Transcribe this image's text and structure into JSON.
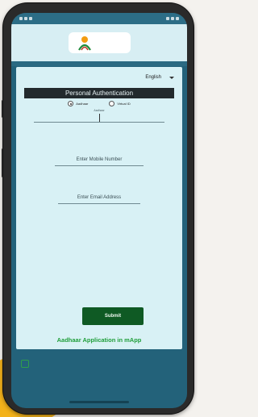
{
  "language": {
    "selected": "English"
  },
  "auth": {
    "title": "Personal Authentication",
    "options": [
      {
        "label": "Aadhaar",
        "selected": true
      },
      {
        "label": "Virtual ID",
        "selected": false
      }
    ],
    "id_caption": "Aadhaar",
    "mobile_label": "Enter Mobile Number",
    "email_label": "Enter Email Address"
  },
  "actions": {
    "submit_label": "Submit",
    "link_text": "Aadhaar Application in mApp"
  },
  "colors": {
    "screen_bg": "#23627a",
    "card_bg": "#d8f1f5",
    "submit_bg": "#0f5a24",
    "link": "#1f9e3a"
  }
}
